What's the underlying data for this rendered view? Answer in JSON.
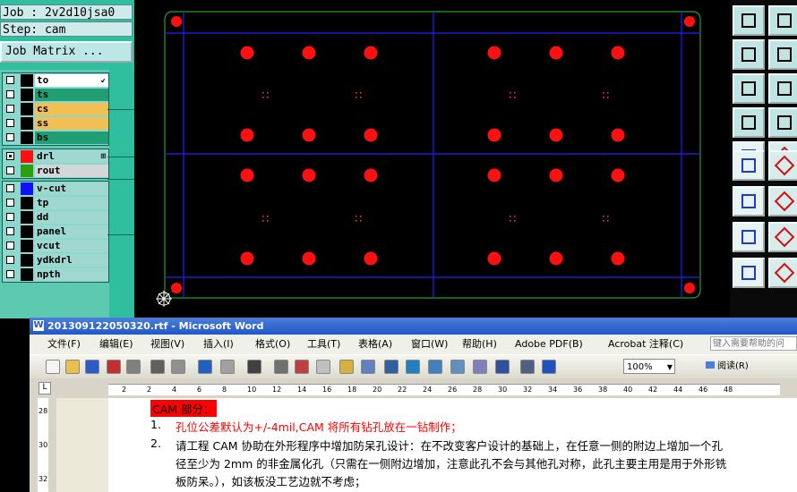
{
  "job_label": "Job : 2v2d10jsa0",
  "step_label": "Step: cam",
  "job_matrix_button": "Job Matrix ...",
  "layer_groups": [
    {
      "layers": [
        {
          "name": "to",
          "color": "#ffffff",
          "mark": "↙",
          "active": false
        },
        {
          "name": "ts",
          "color": "#1f9f73",
          "active": false
        },
        {
          "name": "cs",
          "color": "#f2c052",
          "active": false
        },
        {
          "name": "ss",
          "color": "#f2c052",
          "active": false
        },
        {
          "name": "bs",
          "color": "#1f9f73",
          "active": false
        }
      ]
    },
    {
      "layers": [
        {
          "name": "drl",
          "color": "#9fd8d0",
          "swatch": "#ff1010",
          "mark": "⊞",
          "active": true
        },
        {
          "name": "rout",
          "color": "#d2d8d8",
          "swatch": "#2aa010",
          "active": false
        }
      ]
    },
    {
      "layers": [
        {
          "name": "v-cut",
          "color": "#9fd8d0",
          "swatch": "#1010ff",
          "active": false
        },
        {
          "name": "tp",
          "color": "#9fd8d0",
          "active": false
        },
        {
          "name": "dd",
          "color": "#9fd8d0",
          "active": false
        },
        {
          "name": "panel",
          "color": "#9fd8d0",
          "active": false
        },
        {
          "name": "vcut",
          "color": "#9fd8d0",
          "active": false
        },
        {
          "name": "ydkdrl",
          "color": "#9fd8d0",
          "active": false
        },
        {
          "name": "npth",
          "color": "#9fd8d0",
          "active": false
        }
      ]
    }
  ],
  "tool_icons": [
    "copy-up-icon",
    "copy-down-icon",
    "move-left-icon",
    "move-right-icon",
    "zoom-fit-icon",
    "zoom-window-icon",
    "measure-icon",
    "grid-icon",
    "snap-center-icon",
    "snap-corner-icon",
    "net-icon",
    "cross-icon",
    "line-angle-icon",
    "line-icon",
    "select-pad-icon",
    "line-h-icon",
    "triangle-icon",
    "triangle-warning-icon"
  ],
  "word": {
    "title": "201309122050320.rtf - Microsoft Word",
    "menus": [
      "文件(F)",
      "编辑(E)",
      "视图(V)",
      "插入(I)",
      "格式(O)",
      "工具(T)",
      "表格(A)",
      "窗口(W)",
      "帮助(H)",
      "Adobe PDF(B)",
      "Acrobat 注释(C)"
    ],
    "help_placeholder": "键入需要帮助的问",
    "zoom": "100%",
    "read_button": "阅读(R)",
    "ruler_ticks": [
      "2",
      "2",
      "4",
      "6",
      "8",
      "10",
      "12",
      "14",
      "16",
      "18",
      "20",
      "22",
      "24",
      "26",
      "28",
      "30",
      "32",
      "34",
      "36",
      "38",
      "40",
      "42",
      "44",
      "46",
      "48"
    ],
    "vruler_ticks": [
      "28",
      "30",
      "32"
    ],
    "heading": "CAM 部分：",
    "items": [
      {
        "num": "1.",
        "text": "孔位公差默认为+/-4mil,CAM 将所有钻孔放在一钻制作；",
        "color": "#ff0000"
      },
      {
        "num": "2.",
        "lines": [
          "请工程 CAM 协助在外形程序中增加防呆孔设计：在不改变客户设计的基础上，在任意一侧的附边上增加一个孔",
          "径至少为 2mm 的非金属化孔（只需在一侧附边增加，注意此孔不会与其他孔对称，此孔主要主用是用于外形铣",
          "板防呆。），如该板没工艺边就不考虑；"
        ],
        "color": "#000000"
      }
    ]
  },
  "colors": {
    "accent": "#2fbf9f",
    "drill": "#ff1010",
    "outline": "#2c9a2c",
    "vcut": "#2020ff"
  }
}
